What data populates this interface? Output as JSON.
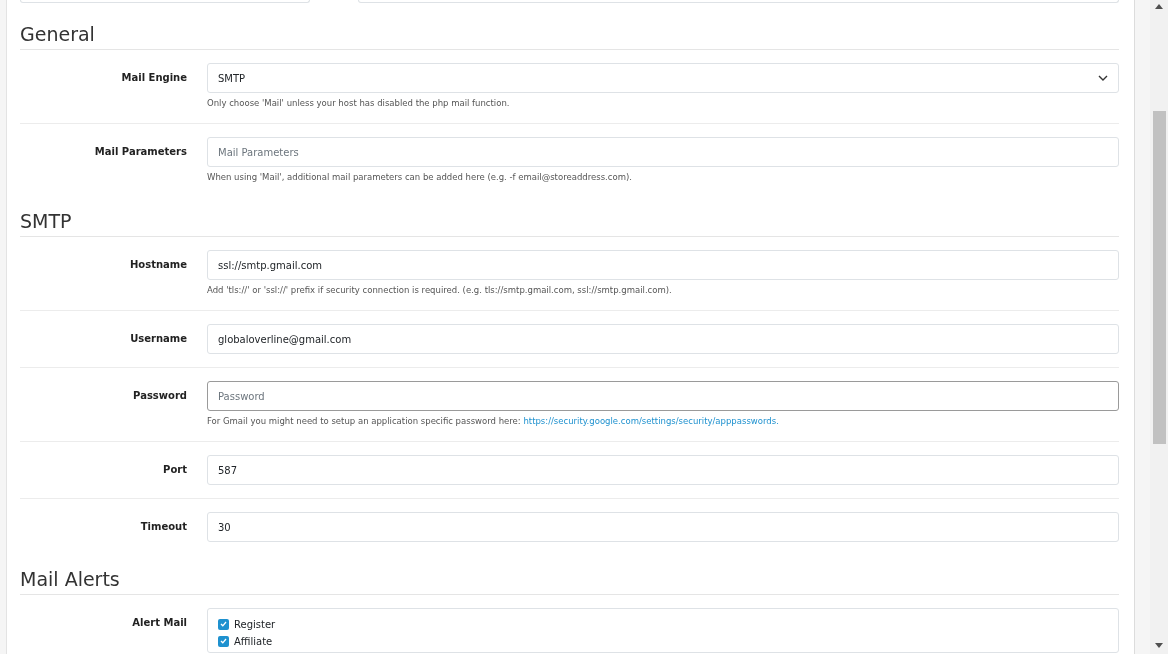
{
  "sections": [
    {
      "title": "General",
      "rows": [
        {
          "label": "Mail Engine",
          "field": {
            "kind": "select",
            "value": "SMTP",
            "focused": false
          },
          "help": "Only choose 'Mail' unless your host has disabled the php mail function."
        },
        {
          "label": "Mail Parameters",
          "field": {
            "kind": "text",
            "placeholder": "Mail Parameters",
            "focused": false
          },
          "help": "When using 'Mail', additional mail parameters can be added here (e.g. -f email@storeaddress.com)."
        }
      ]
    },
    {
      "title": "SMTP",
      "rows": [
        {
          "label": "Hostname",
          "field": {
            "kind": "text",
            "value": "ssl://smtp.gmail.com",
            "focused": false
          },
          "help": "Add 'tls://' or 'ssl://' prefix if security connection is required. (e.g. tls://smtp.gmail.com, ssl://smtp.gmail.com)."
        },
        {
          "label": "Username",
          "field": {
            "kind": "text",
            "value": "globaloverline@gmail.com",
            "focused": false
          }
        },
        {
          "label": "Password",
          "field": {
            "kind": "text",
            "placeholder": "Password",
            "focused": true
          },
          "help": "For Gmail you might need to setup an application specific password here:",
          "help_link": "https://security.google.com/settings/security/apppasswords."
        },
        {
          "label": "Port",
          "field": {
            "kind": "text",
            "value": "587",
            "focused": false
          }
        },
        {
          "label": "Timeout",
          "field": {
            "kind": "text",
            "value": "30",
            "focused": false
          }
        }
      ]
    },
    {
      "title": "Mail Alerts",
      "rows": [
        {
          "label": "Alert Mail",
          "field": {
            "kind": "checklist",
            "items": [
              {
                "label": "Register",
                "checked": true
              },
              {
                "label": "Affiliate",
                "checked": true
              }
            ]
          }
        }
      ]
    }
  ]
}
